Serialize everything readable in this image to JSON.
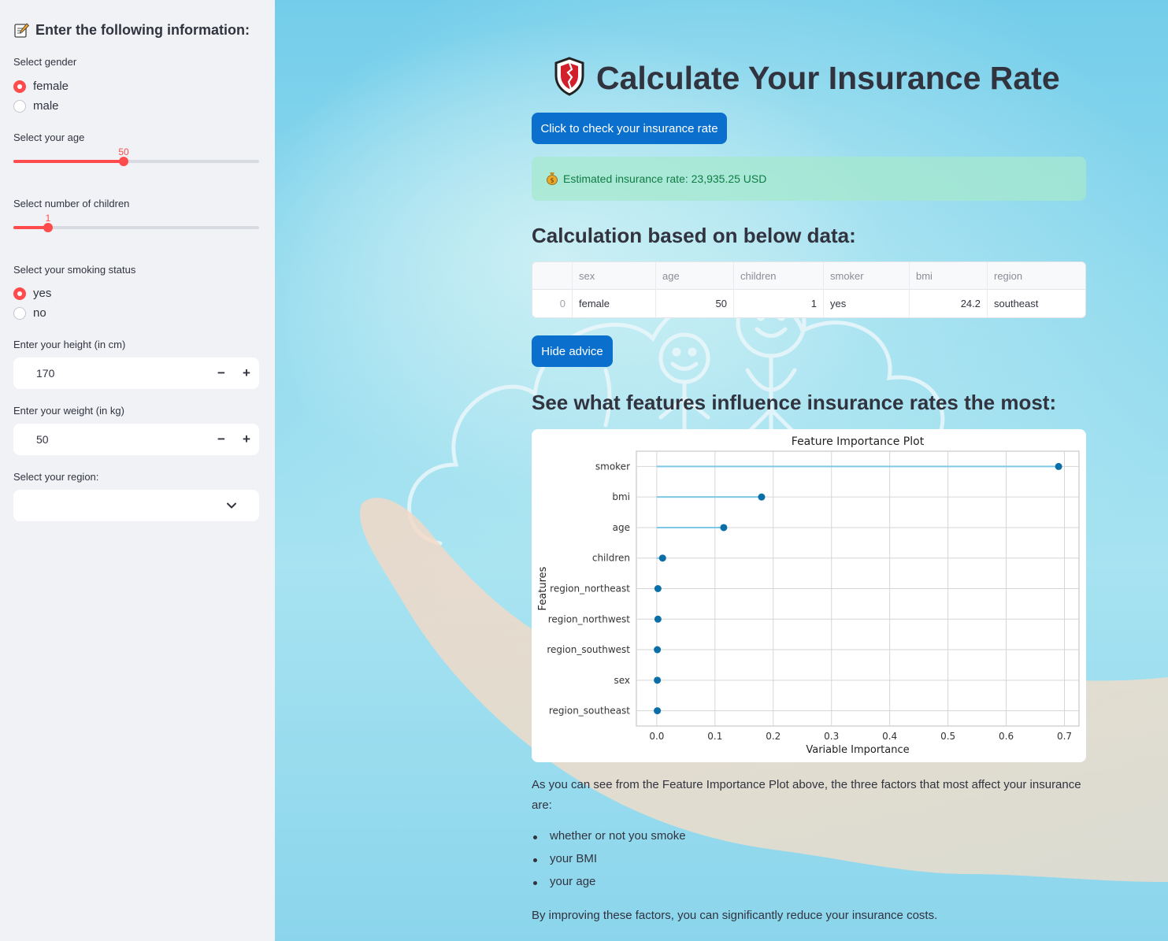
{
  "sidebar": {
    "title": "Enter the following information:",
    "gender": {
      "label": "Select gender",
      "options": [
        "female",
        "male"
      ],
      "selected": "female"
    },
    "age": {
      "label": "Select your age",
      "value": "50",
      "fraction": 0.45
    },
    "children": {
      "label": "Select number of children",
      "value": "1",
      "fraction": 0.14
    },
    "smoking": {
      "label": "Select your smoking status",
      "options": [
        "yes",
        "no"
      ],
      "selected": "yes"
    },
    "height": {
      "label": "Enter your height (in cm)",
      "value": "170"
    },
    "weight": {
      "label": "Enter your weight (in kg)",
      "value": "50"
    },
    "region": {
      "label": "Select your region:",
      "value": ""
    },
    "minus": "−",
    "plus": "+"
  },
  "main": {
    "title": "Calculate Your Insurance Rate",
    "check_button": "Click to check your insurance rate",
    "estimate": "Estimated insurance rate: 23,935.25 USD",
    "data_heading": "Calculation based on below data:",
    "table": {
      "columns": [
        "",
        "sex",
        "age",
        "children",
        "smoker",
        "bmi",
        "region"
      ],
      "rows": [
        [
          "0",
          "female",
          "50",
          "1",
          "yes",
          "24.2",
          "southeast"
        ]
      ]
    },
    "advice_button": "Hide advice",
    "features_heading": "See what features influence insurance rates the most:",
    "paragraph1": "As you can see from the Feature Importance Plot above, the three factors that most affect your insurance are:",
    "bullets": [
      "whether or not you smoke",
      "your BMI",
      "your age"
    ],
    "paragraph2": "By improving these factors, you can significantly reduce your insurance costs."
  },
  "colors": {
    "accent": "#ff4b4b",
    "button": "#0b70cd",
    "success_text": "#0f7b45",
    "dot": "#0a6fa8",
    "stem": "#7ec8e6"
  },
  "icons": [
    "memo-icon",
    "shield-icon",
    "money-bag-icon",
    "chevron-down-icon"
  ],
  "chart_data": {
    "type": "scatter",
    "title": "Feature Importance Plot",
    "xlabel": "Variable Importance",
    "ylabel": "Features",
    "categories": [
      "smoker",
      "bmi",
      "age",
      "children",
      "region_northeast",
      "region_northwest",
      "region_southwest",
      "sex",
      "region_southeast"
    ],
    "values": [
      0.69,
      0.18,
      0.115,
      0.01,
      0.002,
      0.002,
      0.001,
      0.001,
      0.001
    ],
    "xticks": [
      0.0,
      0.1,
      0.2,
      0.3,
      0.4,
      0.5,
      0.6,
      0.7
    ],
    "xlim": [
      -0.035,
      0.725
    ],
    "grid": true
  }
}
